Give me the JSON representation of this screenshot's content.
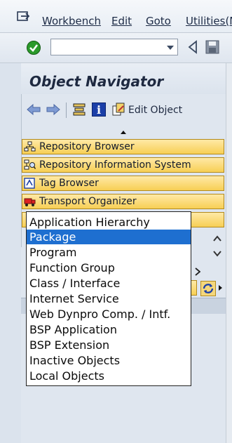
{
  "menubar": {
    "items": [
      "Workbench",
      "Edit",
      "Goto",
      "Utilities(M"
    ]
  },
  "toolbar": {
    "command_value": ""
  },
  "header": {
    "title": "Object Navigator"
  },
  "nav_toolbar": {
    "edit_object_label": "Edit Object"
  },
  "tools": [
    {
      "label": "Repository Browser",
      "icon": "repository-browser-icon"
    },
    {
      "label": "Repository Information System",
      "icon": "repository-info-icon"
    },
    {
      "label": "Tag Browser",
      "icon": "tag-browser-icon"
    },
    {
      "label": "Transport Organizer",
      "icon": "transport-truck-icon"
    }
  ],
  "object_list_dropdown": {
    "selected": "Package",
    "options": [
      "Application Hierarchy",
      "Package",
      "Program",
      "Function Group",
      "Class / Interface",
      "Internet Service",
      "Web Dynpro Comp. / Intf.",
      "BSP Application",
      "BSP Extension",
      "Inactive Objects",
      "Local Objects"
    ]
  },
  "colors": {
    "tool_button": "#f7cf55",
    "selection": "#1e6fd0",
    "title_text": "#1e2940"
  }
}
